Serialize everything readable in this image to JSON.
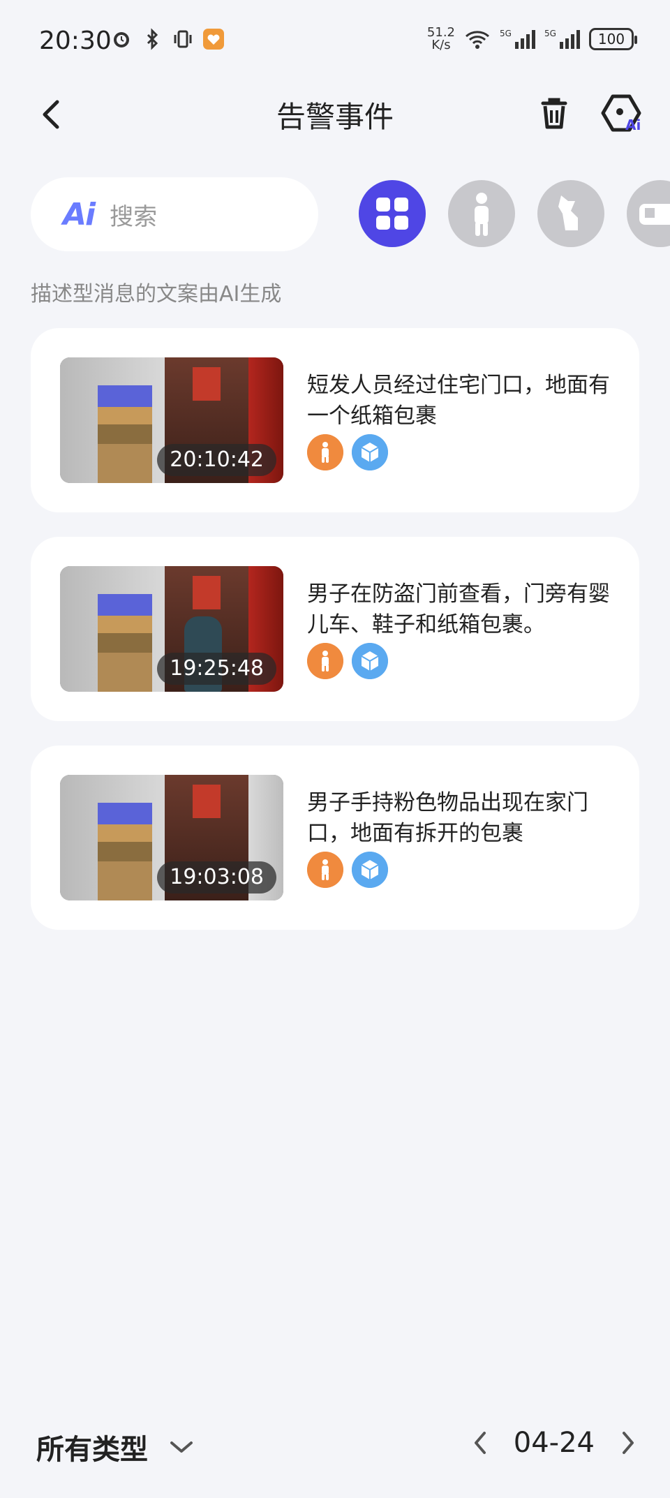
{
  "status_bar": {
    "time": "20:30",
    "net_speed_value": "51.2",
    "net_speed_unit": "K/s",
    "battery": "100",
    "signal_1_label": "5G",
    "signal_2_label": "5G",
    "wifi_label": "7"
  },
  "header": {
    "title": "告警事件"
  },
  "search": {
    "ai_badge": "Ai",
    "placeholder": "搜索"
  },
  "filters": [
    {
      "icon": "grid-icon",
      "active": true
    },
    {
      "icon": "person-icon",
      "active": false
    },
    {
      "icon": "pet-icon",
      "active": false
    },
    {
      "icon": "vehicle-icon",
      "active": false
    }
  ],
  "ai_note": "描述型消息的文案由AI生成",
  "events": [
    {
      "time": "20:10:42",
      "description": "短发人员经过住宅门口，地面有一个纸箱包裹",
      "tags": [
        "person-icon",
        "package-icon"
      ]
    },
    {
      "time": "19:25:48",
      "description": "男子在防盗门前查看，门旁有婴儿车、鞋子和纸箱包裹。",
      "tags": [
        "person-icon",
        "package-icon"
      ]
    },
    {
      "time": "19:03:08",
      "description": "男子手持粉色物品出现在家门口，地面有拆开的包裹",
      "tags": [
        "person-icon",
        "package-icon"
      ]
    }
  ],
  "bottom_bar": {
    "type_filter": "所有类型",
    "date": "04-24"
  },
  "colors": {
    "accent": "#4f46e5",
    "person_tag": "#f08a3e",
    "package_tag": "#5aa9f0",
    "background": "#f4f5f9"
  }
}
